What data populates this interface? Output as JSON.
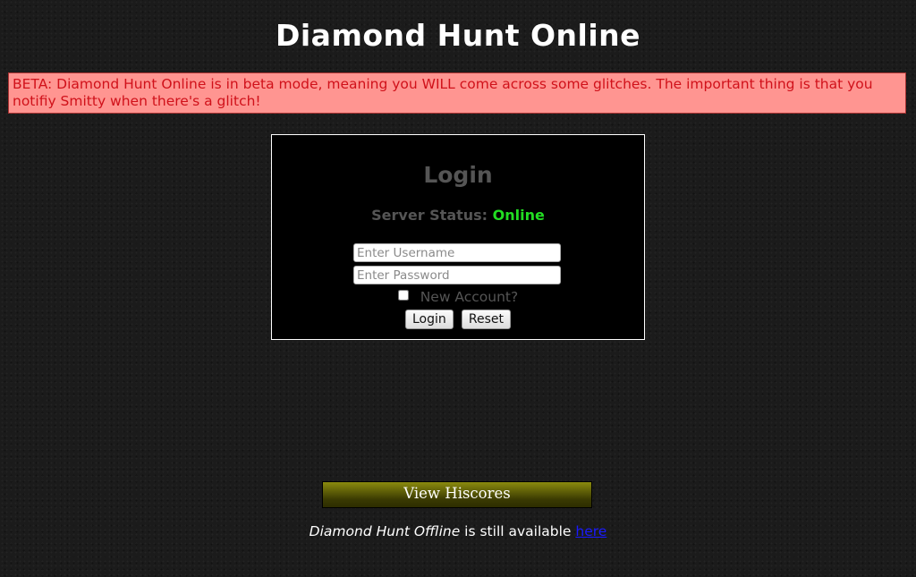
{
  "header": {
    "title": "Diamond Hunt Online"
  },
  "beta_notice": {
    "text": "BETA: Diamond Hunt Online is in beta mode, meaning you WILL come across some glitches. The important thing is that you notifiy Smitty when there's a glitch!",
    "bg_color": "#ff9591",
    "text_color": "#d0111a"
  },
  "login": {
    "title": "Login",
    "server_status_label": "Server Status:",
    "server_status_value": "Online",
    "status_color": "#22dd22",
    "username_placeholder": "Enter Username",
    "username_value": "",
    "password_placeholder": "Enter Password",
    "password_value": "",
    "new_account_label": "New Account?",
    "new_account_checked": false,
    "login_button": "Login",
    "reset_button": "Reset"
  },
  "hiscores": {
    "label": "View Hiscores"
  },
  "footer": {
    "offline_name": "Diamond Hunt Offline",
    "offline_text": " is still available ",
    "link_text": "here"
  }
}
